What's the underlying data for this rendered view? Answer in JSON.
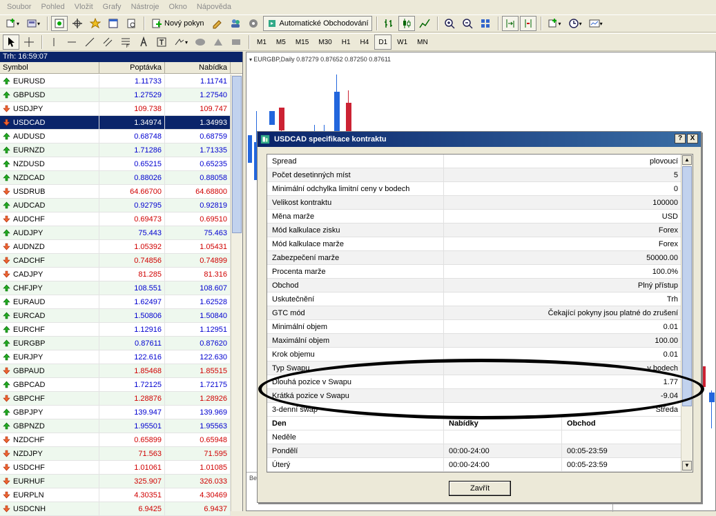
{
  "menu": [
    "Soubor",
    "Pohled",
    "Vložit",
    "Grafy",
    "Nástroje",
    "Okno",
    "Nápověda"
  ],
  "toolbar": {
    "new_order_label": "Nový pokyn",
    "auto_trading_label": "Automatické Obchodování",
    "timeframes": [
      "M1",
      "M5",
      "M15",
      "M30",
      "H1",
      "H4",
      "D1",
      "W1",
      "MN"
    ],
    "active_timeframe": "D1"
  },
  "market_watch": {
    "title": "Trh: 16:59:07",
    "columns": [
      "Symbol",
      "Poptávka",
      "Nabídka"
    ],
    "rows": [
      {
        "symbol": "EURUSD",
        "bid": "1.11733",
        "ask": "1.11741",
        "dir": "up"
      },
      {
        "symbol": "GBPUSD",
        "bid": "1.27529",
        "ask": "1.27540",
        "dir": "up"
      },
      {
        "symbol": "USDJPY",
        "bid": "109.738",
        "ask": "109.747",
        "dir": "dn"
      },
      {
        "symbol": "USDCAD",
        "bid": "1.34974",
        "ask": "1.34993",
        "dir": "dn",
        "selected": true
      },
      {
        "symbol": "AUDUSD",
        "bid": "0.68748",
        "ask": "0.68759",
        "dir": "up"
      },
      {
        "symbol": "EURNZD",
        "bid": "1.71286",
        "ask": "1.71335",
        "dir": "up"
      },
      {
        "symbol": "NZDUSD",
        "bid": "0.65215",
        "ask": "0.65235",
        "dir": "up"
      },
      {
        "symbol": "NZDCAD",
        "bid": "0.88026",
        "ask": "0.88058",
        "dir": "up"
      },
      {
        "symbol": "USDRUB",
        "bid": "64.66700",
        "ask": "64.68800",
        "dir": "dn"
      },
      {
        "symbol": "AUDCAD",
        "bid": "0.92795",
        "ask": "0.92819",
        "dir": "up"
      },
      {
        "symbol": "AUDCHF",
        "bid": "0.69473",
        "ask": "0.69510",
        "dir": "dn"
      },
      {
        "symbol": "AUDJPY",
        "bid": "75.443",
        "ask": "75.463",
        "dir": "up"
      },
      {
        "symbol": "AUDNZD",
        "bid": "1.05392",
        "ask": "1.05431",
        "dir": "dn"
      },
      {
        "symbol": "CADCHF",
        "bid": "0.74856",
        "ask": "0.74899",
        "dir": "dn"
      },
      {
        "symbol": "CADJPY",
        "bid": "81.285",
        "ask": "81.316",
        "dir": "dn"
      },
      {
        "symbol": "CHFJPY",
        "bid": "108.551",
        "ask": "108.607",
        "dir": "up"
      },
      {
        "symbol": "EURAUD",
        "bid": "1.62497",
        "ask": "1.62528",
        "dir": "up"
      },
      {
        "symbol": "EURCAD",
        "bid": "1.50806",
        "ask": "1.50840",
        "dir": "up"
      },
      {
        "symbol": "EURCHF",
        "bid": "1.12916",
        "ask": "1.12951",
        "dir": "up"
      },
      {
        "symbol": "EURGBP",
        "bid": "0.87611",
        "ask": "0.87620",
        "dir": "up"
      },
      {
        "symbol": "EURJPY",
        "bid": "122.616",
        "ask": "122.630",
        "dir": "up"
      },
      {
        "symbol": "GBPAUD",
        "bid": "1.85468",
        "ask": "1.85515",
        "dir": "dn"
      },
      {
        "symbol": "GBPCAD",
        "bid": "1.72125",
        "ask": "1.72175",
        "dir": "up"
      },
      {
        "symbol": "GBPCHF",
        "bid": "1.28876",
        "ask": "1.28926",
        "dir": "dn"
      },
      {
        "symbol": "GBPJPY",
        "bid": "139.947",
        "ask": "139.969",
        "dir": "up"
      },
      {
        "symbol": "GBPNZD",
        "bid": "1.95501",
        "ask": "1.95563",
        "dir": "up"
      },
      {
        "symbol": "NZDCHF",
        "bid": "0.65899",
        "ask": "0.65948",
        "dir": "dn"
      },
      {
        "symbol": "NZDJPY",
        "bid": "71.563",
        "ask": "71.595",
        "dir": "dn"
      },
      {
        "symbol": "USDCHF",
        "bid": "1.01061",
        "ask": "1.01085",
        "dir": "dn"
      },
      {
        "symbol": "EURHUF",
        "bid": "325.907",
        "ask": "326.033",
        "dir": "dn"
      },
      {
        "symbol": "EURPLN",
        "bid": "4.30351",
        "ask": "4.30469",
        "dir": "dn"
      },
      {
        "symbol": "USDCNH",
        "bid": "6.9425",
        "ask": "6.9437",
        "dir": "dn"
      }
    ]
  },
  "chart": {
    "title": "EURGBP,Daily  0.87279 0.87652 0.87250 0.87611",
    "bottom_label": "Be"
  },
  "dialog": {
    "title": "USDCAD specifikace kontraktu",
    "help_label": "?",
    "close_label": "X",
    "specs": [
      {
        "k": "Spread",
        "v": "plovoucí"
      },
      {
        "k": "Počet desetinných míst",
        "v": "5"
      },
      {
        "k": "Minimální odchylka limitní ceny v bodech",
        "v": "0"
      },
      {
        "k": "Velikost kontraktu",
        "v": "100000"
      },
      {
        "k": "Měna marže",
        "v": "USD"
      },
      {
        "k": "Mód kalkulace zisku",
        "v": "Forex"
      },
      {
        "k": "Mód kalkulace marže",
        "v": "Forex"
      },
      {
        "k": "Zabezpečení marže",
        "v": "50000.00"
      },
      {
        "k": "Procenta marže",
        "v": "100.0%"
      },
      {
        "k": "Obchod",
        "v": "Plný přístup"
      },
      {
        "k": "Uskutečnění",
        "v": "Trh"
      },
      {
        "k": "GTC mód",
        "v": "Čekající pokyny jsou platné do zrušení"
      },
      {
        "k": "Minimální objem",
        "v": "0.01"
      },
      {
        "k": "Maximální objem",
        "v": "100.00"
      },
      {
        "k": "Krok objemu",
        "v": "0.01"
      },
      {
        "k": "Typ Swapu",
        "v": "v bodech"
      },
      {
        "k": "Dlouhá pozice v Swapu",
        "v": "1.77"
      },
      {
        "k": "Krátká pozice v Swapu",
        "v": "-9.04"
      },
      {
        "k": "3-denní swap",
        "v": "Středa"
      }
    ],
    "sessions_header": [
      "Den",
      "Nabídky",
      "Obchod"
    ],
    "sessions": [
      {
        "day": "Neděle",
        "quotes": "",
        "trade": ""
      },
      {
        "day": "Pondělí",
        "quotes": "00:00-24:00",
        "trade": "00:05-23:59"
      },
      {
        "day": "Úterý",
        "quotes": "00:00-24:00",
        "trade": "00:05-23:59"
      }
    ],
    "close_button_label": "Zavřít"
  },
  "colors": {
    "up": "#0000d0",
    "down": "#d00000",
    "selection": "#0a246a",
    "title_bar": "#0a246a"
  }
}
